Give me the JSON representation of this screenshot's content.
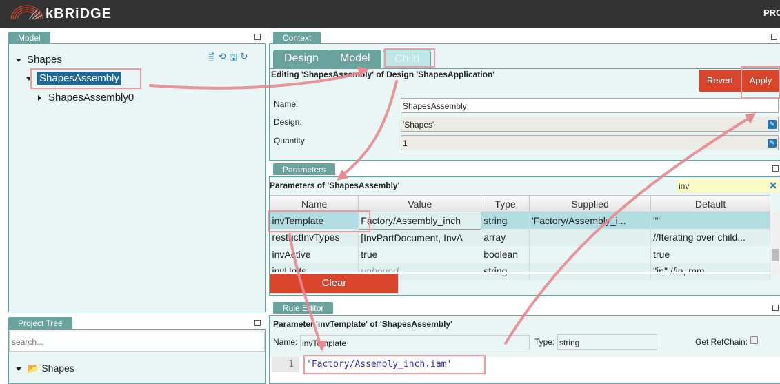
{
  "header": {
    "brand": "kBRiDGE",
    "right_text": "PRO"
  },
  "model_panel": {
    "tab": "Model",
    "tree": [
      {
        "label": "Shapes",
        "expanded": true
      },
      {
        "label": "ShapesAssembly",
        "selected": true,
        "expanded": true
      },
      {
        "label": "ShapesAssembly0",
        "expanded": false
      }
    ],
    "toolbar_icons": [
      "code-file-icon",
      "history-icon",
      "save-icon",
      "refresh-icon"
    ]
  },
  "project_tree": {
    "tab": "Project Tree",
    "search_placeholder": "search...",
    "root": "Shapes"
  },
  "context": {
    "tab": "Context",
    "tabs": [
      "Design",
      "Model",
      "Child"
    ],
    "active_tab": "Child",
    "editing_text": "Editing 'ShapesAssembly' of Design 'ShapesApplication'",
    "revert": "Revert",
    "apply": "Apply",
    "name_label": "Name:",
    "name_value": "ShapesAssembly",
    "design_label": "Design:",
    "design_value": "'Shapes'",
    "quantity_label": "Quantity:",
    "quantity_value": "1"
  },
  "parameters": {
    "tab": "Parameters",
    "title": "Parameters of 'ShapesAssembly'",
    "filter": "inv",
    "columns": [
      "Name",
      "Value",
      "Type",
      "Supplied",
      "Default"
    ],
    "rows": [
      [
        "invTemplate",
        "Factory/Assembly_inch",
        "string",
        "'Factory/Assembly_i...",
        "\"\""
      ],
      [
        "restrictInvTypes",
        "[InvPartDocument, InvA",
        "array",
        "",
        "//Iterating over child..."
      ],
      [
        "invActive",
        "true",
        "boolean",
        "",
        "true"
      ],
      [
        "invUnits",
        "unbound",
        "string",
        "",
        "\"in\" //in, mm"
      ]
    ],
    "clear": "Clear"
  },
  "rule_editor": {
    "tab": "Rule Editor",
    "title": "Parameter 'invTemplate' of 'ShapesAssembly'",
    "name_label": "Name:",
    "name_value": "invTemplate",
    "type_label": "Type:",
    "type_value": "string",
    "refchain_label": "Get RefChain:",
    "line_number": "1",
    "code": "'Factory/Assembly_inch.iam'"
  },
  "colors": {
    "header": "#333333",
    "accent": "#6aa39e",
    "button": "#d9442a",
    "selection": "#1f6699",
    "annotation": "#ee9aa0"
  }
}
